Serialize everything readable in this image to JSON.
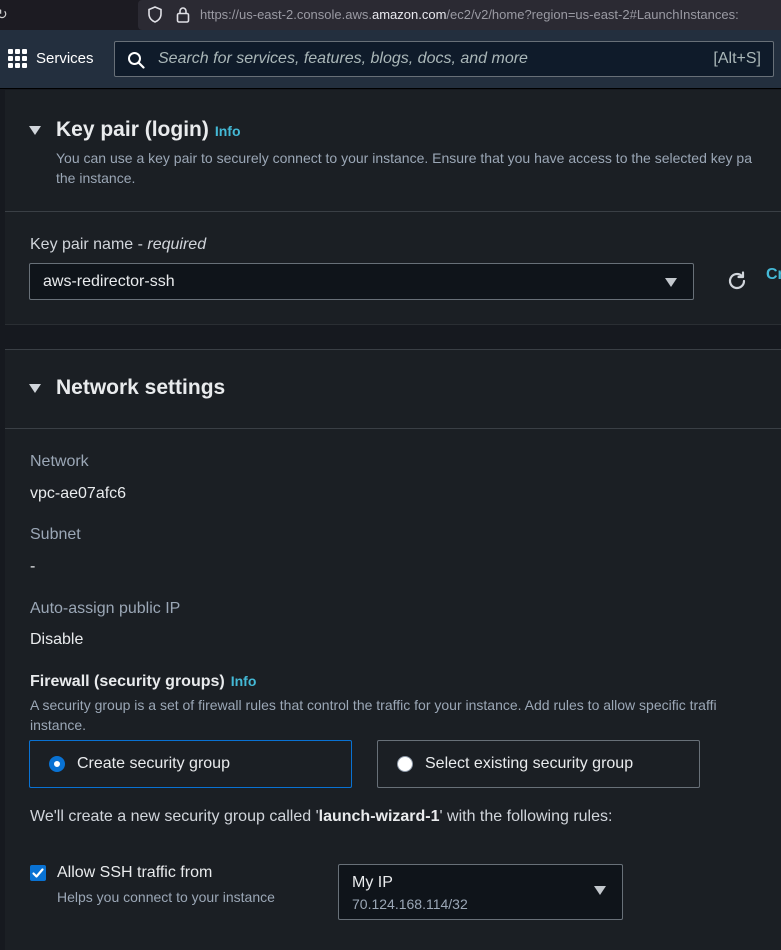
{
  "browser": {
    "url_prefix": "https://us-east-2.console.aws.",
    "url_domain": "amazon.com",
    "url_suffix": "/ec2/v2/home?region=us-east-2#LaunchInstances:"
  },
  "topnav": {
    "services_label": "Services",
    "search_placeholder": "Search for services, features, blogs, docs, and more",
    "search_shortcut": "[Alt+S]"
  },
  "key_pair": {
    "title": "Key pair (login)",
    "info": "Info",
    "description_line1": "You can use a key pair to securely connect to your instance. Ensure that you have access to the selected key pa",
    "description_line2": "the instance.",
    "field_label": "Key pair name - ",
    "field_label_required": "required",
    "selected_value": "aws-redirector-ssh",
    "create_link_partial": "Cr"
  },
  "network": {
    "title": "Network settings",
    "network_label": "Network",
    "network_value": "vpc-ae07afc6",
    "subnet_label": "Subnet",
    "subnet_value": "-",
    "public_ip_label": "Auto-assign public IP",
    "public_ip_value": "Disable",
    "firewall_title": "Firewall (security groups)",
    "firewall_info": "Info",
    "firewall_desc_line1": "A security group is a set of firewall rules that control the traffic for your instance. Add rules to allow specific traffi",
    "firewall_desc_line2": "instance.",
    "options": [
      {
        "label": "Create security group",
        "selected": true
      },
      {
        "label": "Select existing security group",
        "selected": false
      }
    ],
    "create_note_prefix": "We'll create a new security group called '",
    "create_note_name": "launch-wizard-1",
    "create_note_suffix": "' with the following rules:",
    "ssh_rule": {
      "label": "Allow SSH traffic from",
      "help": "Helps you connect to your instance",
      "checked": true,
      "source": "My IP",
      "source_detail": "70.124.168.114/32"
    }
  },
  "colors": {
    "accent": "#0972d3",
    "link": "#44b9d6",
    "nav_bg": "#232f3e",
    "panel_bg": "#1b1f24"
  }
}
